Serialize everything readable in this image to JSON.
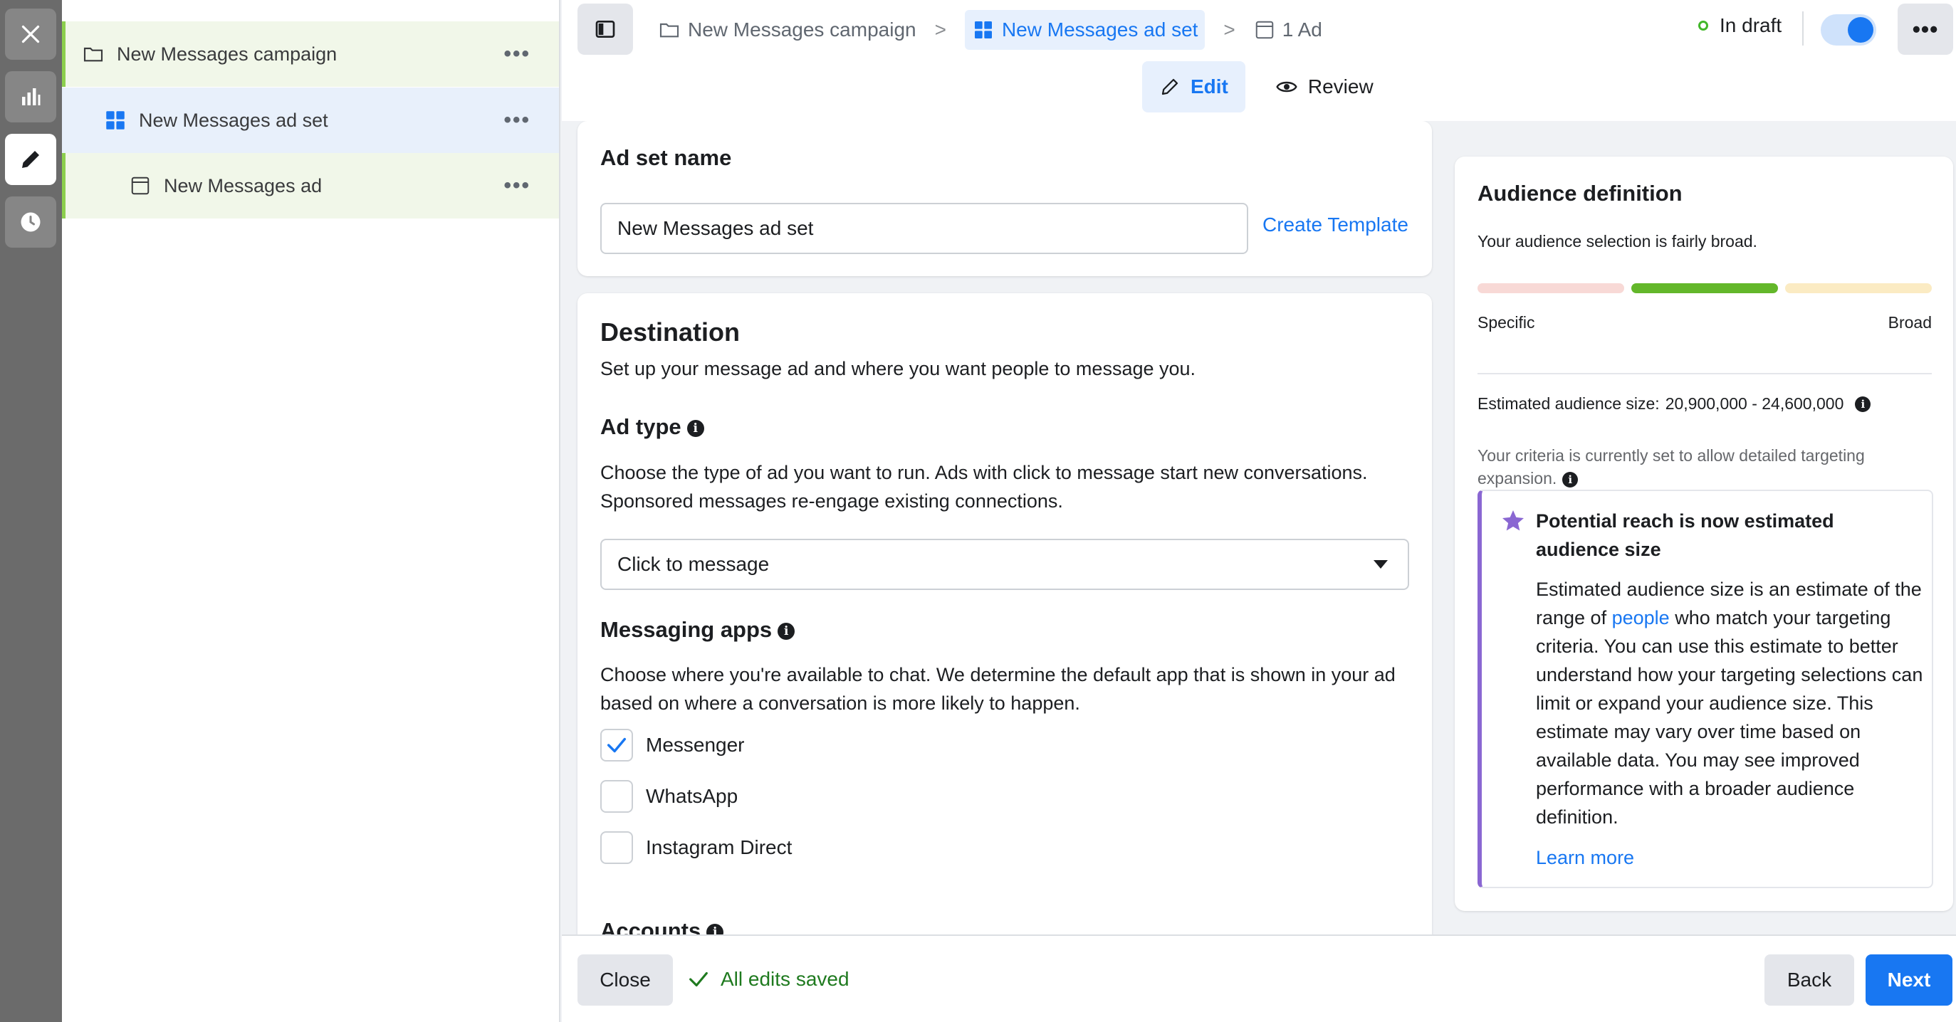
{
  "tree": {
    "campaign": "New Messages campaign",
    "adset": "New Messages ad set",
    "ad": "New Messages ad",
    "more": "•••"
  },
  "header": {
    "breadcrumbs": [
      "New Messages campaign",
      "New Messages ad set",
      "1 Ad"
    ],
    "status": "In draft",
    "more": "•••",
    "tabs": [
      "Edit",
      "Review"
    ]
  },
  "adset_name": {
    "heading": "Ad set name",
    "value": "New Messages ad set",
    "template_link": "Create Template"
  },
  "destination": {
    "heading": "Destination",
    "description": "Set up your message ad and where you want people to message you.",
    "ad_type": {
      "heading": "Ad type",
      "description": "Choose the type of ad you want to run. Ads with click to message start new conversations. Sponsored messages re-engage existing connections.",
      "selected": "Click to message"
    },
    "messaging_apps": {
      "heading": "Messaging apps",
      "description": "Choose where you're available to chat. We determine the default app that is shown in your ad based on where a conversation is more likely to happen.",
      "options": [
        {
          "label": "Messenger",
          "checked": true
        },
        {
          "label": "WhatsApp",
          "checked": false
        },
        {
          "label": "Instagram Direct",
          "checked": false
        }
      ]
    },
    "accounts_heading": "Accounts"
  },
  "audience": {
    "heading": "Audience definition",
    "summary": "Your audience selection is fairly broad.",
    "scale_left": "Specific",
    "scale_right": "Broad",
    "estimated_label": "Estimated audience size:",
    "estimated_value": "20,900,000 - 24,600,000",
    "criteria_note": "Your criteria is currently set to allow detailed targeting expansion.",
    "reach_title": "Potential reach is now estimated audience size",
    "reach_body_1": "Estimated audience size is an estimate of the range of",
    "reach_link": "people",
    "reach_body_2": "who match your targeting criteria. You can use this estimate to better understand how your targeting selections can limit or expand your audience size. This estimate may vary over time based on available data. You may see improved performance with a broader audience definition.",
    "learn_more": "Learn more"
  },
  "footer": {
    "close": "Close",
    "saved": "All edits saved",
    "back": "Back",
    "next": "Next"
  },
  "colors": {
    "accent": "#1877f2",
    "tree_green": "#8ccf4d",
    "meter_active": "#63b72a",
    "meter_specific": "#f8d9d6",
    "meter_broad": "#fbebc3",
    "reach_purple": "#8a67d2"
  }
}
